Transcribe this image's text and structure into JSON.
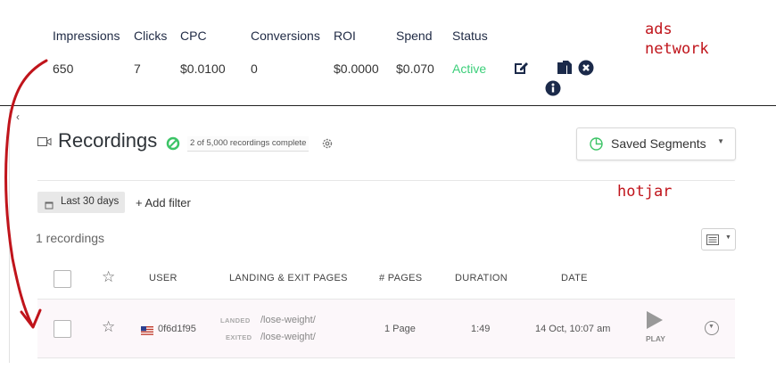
{
  "ads": {
    "headers": [
      "Impressions",
      "Clicks",
      "CPC",
      "Conversions",
      "ROI",
      "Spend",
      "Status"
    ],
    "row": {
      "impressions": "650",
      "clicks": "7",
      "cpc": "$0.0100",
      "conversions": "0",
      "roi": "$0.0000",
      "spend": "$0.070",
      "status": "Active"
    },
    "status_color": "#3ccf7a",
    "icons": [
      "edit-icon",
      "copy-icon",
      "delete-icon",
      "info-icon"
    ]
  },
  "annotations": {
    "ads_label_line1": "ads",
    "ads_label_line2": "network",
    "hotjar_label": "hotjar",
    "color": "#c0141b"
  },
  "hotjar": {
    "title": "Recordings",
    "progress_text": "2 of 5,000 recordings complete",
    "saved_segments_label": "Saved Segments",
    "date_filter_label": "Last 30 days",
    "add_filter_label": "+ Add filter",
    "recordings_count": "1 recordings",
    "columns": {
      "user": "USER",
      "pages": "LANDING & EXIT PAGES",
      "num_pages": "# PAGES",
      "duration": "DURATION",
      "date": "DATE"
    },
    "row": {
      "user_id": "0f6d1f95",
      "landed_label": "LANDED",
      "landed_path": "/lose-weight/",
      "exited_label": "EXITED",
      "exited_path": "/lose-weight/",
      "num_pages": "1 Page",
      "duration": "1:49",
      "date": "14 Oct, 10:07 am",
      "play_label": "PLAY"
    },
    "accent_color": "#3cc466"
  }
}
